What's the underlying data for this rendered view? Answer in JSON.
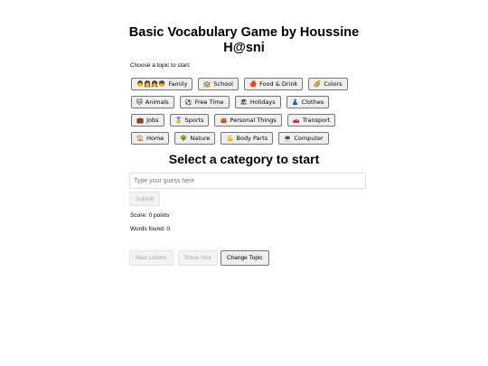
{
  "header": {
    "title": "Basic Vocabulary Game by Houssine H@sni"
  },
  "topic_prompt": "Choose a topic to start:",
  "topics": [
    {
      "icon": "👨👩👧👦",
      "label": "Family"
    },
    {
      "icon": "🏫",
      "label": "School"
    },
    {
      "icon": "🍎",
      "label": "Food & Drink"
    },
    {
      "icon": "🌈",
      "label": "Colors"
    },
    {
      "icon": "🐱",
      "label": "Animals"
    },
    {
      "icon": "⚽",
      "label": "Free Time"
    },
    {
      "icon": "🏖",
      "label": "Holidays"
    },
    {
      "icon": "👗",
      "label": "Clothes"
    },
    {
      "icon": "💼",
      "label": "Jobs"
    },
    {
      "icon": "🏅",
      "label": "Sports"
    },
    {
      "icon": "👜",
      "label": "Personal Things"
    },
    {
      "icon": "🚗",
      "label": "Transport"
    },
    {
      "icon": "🏠",
      "label": "Home"
    },
    {
      "icon": "🌳",
      "label": "Nature"
    },
    {
      "icon": "💪",
      "label": "Body Parts"
    },
    {
      "icon": "💻",
      "label": "Computer"
    }
  ],
  "game": {
    "category_heading": "Select a category to start",
    "guess_placeholder": "Type your guess here",
    "submit_label": "Submit",
    "score_text": "Score: 0 points",
    "words_found_text": "Words found: 0"
  },
  "actions": {
    "new_letters_label": "New Letters",
    "show_hint_label": "Show Hint",
    "change_topic_label": "Change Topic"
  }
}
